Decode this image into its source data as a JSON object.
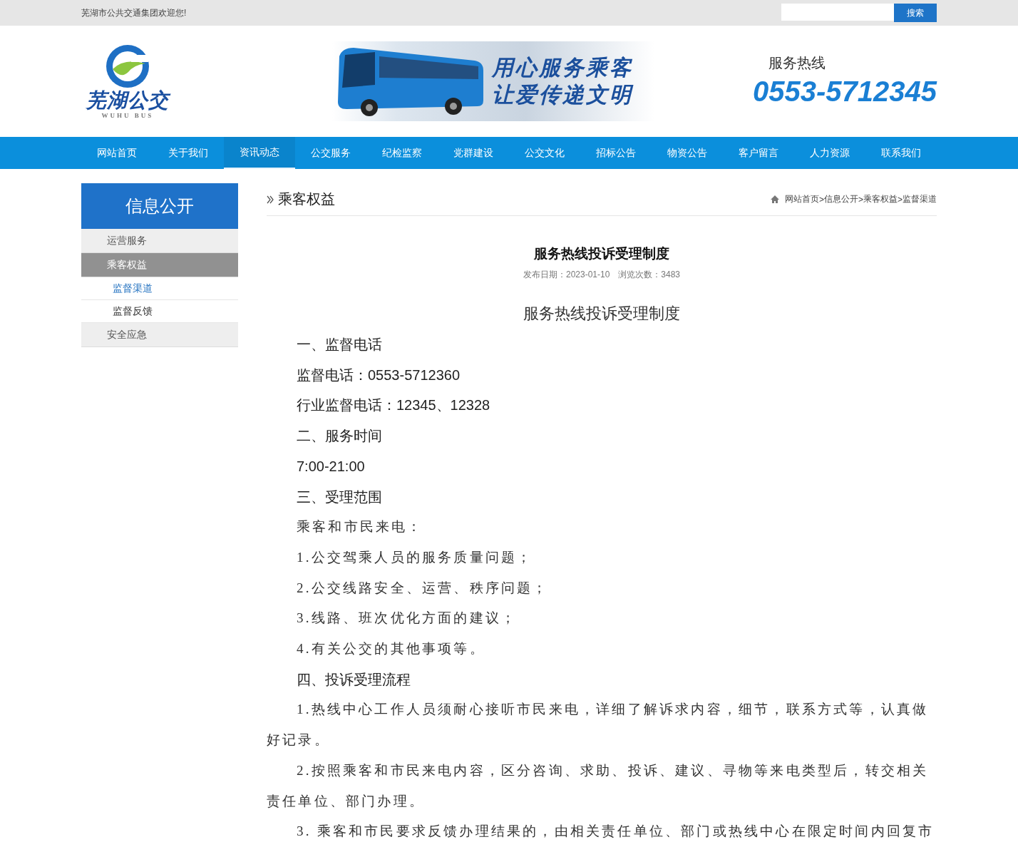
{
  "topbar": {
    "welcome": "芜湖市公共交通集团欢迎您!",
    "search_button": "搜索"
  },
  "header": {
    "logo_text": "芜湖公交",
    "logo_subtext": "WUHU BUS",
    "banner_slogan": [
      "用心服务乘客",
      "让爱传递文明"
    ],
    "hotline_label": "服务热线",
    "hotline_number": "0553-5712345"
  },
  "nav": [
    {
      "label": "网站首页",
      "selected": false
    },
    {
      "label": "关于我们",
      "selected": false
    },
    {
      "label": "资讯动态",
      "selected": true
    },
    {
      "label": "公交服务",
      "selected": false
    },
    {
      "label": "纪检监察",
      "selected": false
    },
    {
      "label": "党群建设",
      "selected": false
    },
    {
      "label": "公交文化",
      "selected": false
    },
    {
      "label": "招标公告",
      "selected": false
    },
    {
      "label": "物资公告",
      "selected": false
    },
    {
      "label": "客户留言",
      "selected": false
    },
    {
      "label": "人力资源",
      "selected": false
    },
    {
      "label": "联系我们",
      "selected": false
    }
  ],
  "sidebar": {
    "title": "信息公开",
    "items": [
      {
        "label": "运营服务",
        "selected": false
      },
      {
        "label": "乘客权益",
        "selected": true,
        "children": [
          {
            "label": "监督渠道",
            "selected": true
          },
          {
            "label": "监督反馈",
            "selected": false
          }
        ]
      },
      {
        "label": "安全应急",
        "selected": false
      }
    ]
  },
  "article": {
    "section_title": "乘客权益",
    "breadcrumb": [
      "网站首页",
      "信息公开",
      "乘客权益",
      "监督渠道"
    ],
    "breadcrumb_separator": ">",
    "title": "服务热线投诉受理制度",
    "publish_date": "发布日期：2023-01-10",
    "views": "浏览次数：3483",
    "content_title": "服务热线投诉受理制度",
    "paragraphs": [
      {
        "kind": "plain",
        "text": "一、监督电话"
      },
      {
        "kind": "plain",
        "text": "监督电话：0553-5712360"
      },
      {
        "kind": "plain",
        "text": "行业监督电话：12345、12328"
      },
      {
        "kind": "plain",
        "text": "二、服务时间"
      },
      {
        "kind": "plain",
        "text": "7:00-21:00"
      },
      {
        "kind": "plain",
        "text": "三、受理范围"
      },
      {
        "kind": "serif",
        "text": "乘客和市民来电："
      },
      {
        "kind": "serif",
        "text": "1.公交驾乘人员的服务质量问题；"
      },
      {
        "kind": "serif",
        "text": "2.公交线路安全、运营、秩序问题；"
      },
      {
        "kind": "serif",
        "text": "3.线路、班次优化方面的建议；"
      },
      {
        "kind": "serif",
        "text": "4.有关公交的其他事项等。"
      },
      {
        "kind": "plain",
        "text": "四、投诉受理流程"
      },
      {
        "kind": "indent",
        "text": "1.热线中心工作人员须耐心接听市民来电，详细了解诉求内容，细节，联系方式等，认真做好记录。"
      },
      {
        "kind": "indent",
        "text": "2.按照乘客和市民来电内容，区分咨询、求助、投诉、建议、寻物等来电类型后，转交相关责任单位、部门办理。"
      },
      {
        "kind": "indent",
        "text": "3. 乘客和市民要求反馈办理结果的，由相关责任单位、部门或热线中心在限定时间内回复市"
      }
    ]
  }
}
